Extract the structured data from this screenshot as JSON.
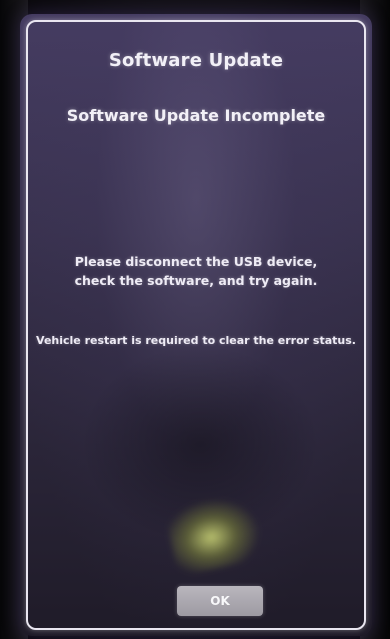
{
  "dialog": {
    "title": "Software Update",
    "subtitle": "Software Update Incomplete",
    "message_line1": "Please disconnect the USB device,",
    "message_line2": "check the software, and try again.",
    "restart_notice": "Vehicle restart is required to clear the error status.",
    "ok_label": "OK"
  },
  "colors": {
    "screen_background": "#39324f",
    "border": "#e9e6f0",
    "text": "#f2f0f7",
    "button": "#a9a6ae"
  }
}
